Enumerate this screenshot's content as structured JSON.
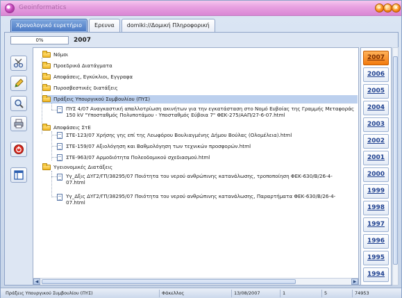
{
  "window": {
    "title": "Geoinformatics"
  },
  "tabs": [
    {
      "label": "Χρονολογικό ευρετήριο",
      "active": true
    },
    {
      "label": "Ερευνα",
      "active": false
    },
    {
      "label": "domiki://Δομική Πληροφορική",
      "active": false
    }
  ],
  "progress": {
    "label": "0%",
    "value": 0
  },
  "current_year": "2007",
  "toolbar": [
    "scissors-icon",
    "edit-icon",
    "search-icon",
    "printer-icon",
    "power-icon",
    "layout-icon"
  ],
  "tree": {
    "folders": {
      "nomoi": "Νόμοι",
      "proedrika": "Προεδρικά Διατάγματα",
      "apofaseis": "Αποφάσεις, Εγκύκλιοι, Εγγραφα",
      "pyrosvestikes": "Πυροσβεστικές διατάξεις",
      "pys": "Πράξεις Υπουργικού Συμβουλίου (ΠΥΣ)",
      "ste": "Αποφάσεις ΣτΕ",
      "ygeionomikes": "Υγειονομικές Διατάξεις"
    },
    "files": {
      "pys_1": "ΠΥΣ 4/07 Αναγκαστική απαλλοτρίωση ακινήτων για την εγκατάσταση στο Νομό Ευβοίας της Γραμμής Μεταφοράς 150 kV \"Υποσταθμός Πολυποτάμου - Υποσταθμός Εύβοια 7\" ΦΕΚ-275/ΑΑΠ/27-6-07.html",
      "ste_1": "ΣΤΕ-123/07 Χρήσης γης επί της Λεωφόρου Βουλιαγμένης Δήμου Βούλας (Ολομέλεια).html",
      "ste_2": "ΣΤΕ-159/07 Αξιολόγηση και Βαθμολόγηση των τεχνικών προσφορών.html",
      "ste_3": "ΣΤΕ-963/07 Αρμοδιότητα Πολεοδομικού σχεδιασμού.html",
      "yg_1": "Υγ_Δξις ΔΥΓ2/ΓΠ/38295/07 Ποιότητα του νερού ανθρώπινης κατανάλωσης, τροποποίηση ΦΕΚ-630/Β/26-4-07.html",
      "yg_2": "Υγ_Δξις ΔΥΓ2/ΓΠ/38295/07 Ποιότητα του νερού ανθρώπινης κατανάλωσης, Παραρτήματα ΦΕΚ-630/Β/26-4-07.html"
    },
    "selected": "pys"
  },
  "years": [
    "2007",
    "2006",
    "2005",
    "2004",
    "2003",
    "2002",
    "2001",
    "2000",
    "1999",
    "1998",
    "1997",
    "1996",
    "1995",
    "1994"
  ],
  "selected_year": "2007",
  "status": {
    "path": "Πράξεις Υπουργικού Συμβουλίου (ΠΥΣ)",
    "type": "Φάκελλος",
    "date": "13/08/2007",
    "col1": "1",
    "col2": "5",
    "size": "74953"
  },
  "colors": {
    "accent": "#4b79c4",
    "selected_year": "#f27a0e",
    "title_bar": "#e79fe0"
  }
}
